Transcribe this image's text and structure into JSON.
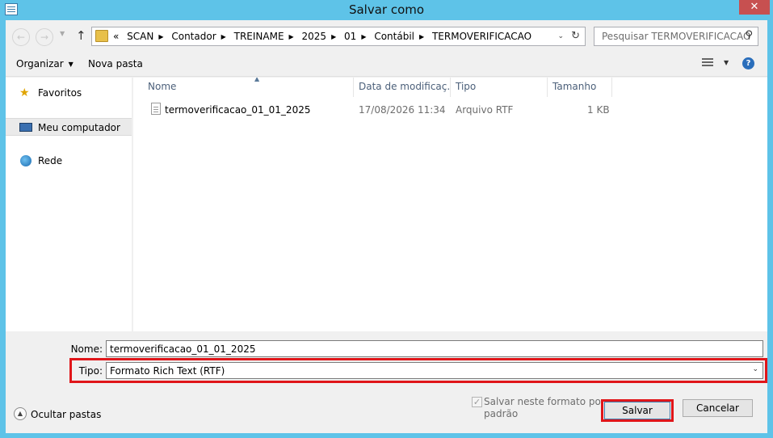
{
  "window": {
    "title": "Salvar como",
    "close_glyph": "✕"
  },
  "nav": {
    "back_glyph": "←",
    "forward_glyph": "→",
    "dropdown_glyph": "▼",
    "up_glyph": "↑"
  },
  "address": {
    "overflow": "«",
    "crumbs": [
      "SCAN",
      "Contador",
      "TREINAME",
      "2025",
      "01",
      "Contábil",
      "TERMOVERIFICACAO"
    ],
    "separator": "▶",
    "dropdown_glyph": "⌄",
    "refresh_glyph": "↻"
  },
  "search": {
    "placeholder": "Pesquisar TERMOVERIFICACAO",
    "icon_glyph": "⚲"
  },
  "toolbar": {
    "organize": "Organizar",
    "caret": "▼",
    "new_folder": "Nova pasta",
    "view_dd": "▼",
    "help_glyph": "?"
  },
  "sidebar": {
    "items": [
      {
        "label": "Favoritos",
        "icon": "star-icon",
        "glyph": "★"
      },
      {
        "label": "Meu computador",
        "icon": "computer-icon"
      },
      {
        "label": "Rede",
        "icon": "network-icon"
      }
    ]
  },
  "filelist": {
    "columns": [
      "Nome",
      "Data de modificaç...",
      "Tipo",
      "Tamanho"
    ],
    "sort_glyph": "▲",
    "rows": [
      {
        "name": "termoverificacao_01_01_2025",
        "modified": "17/08/2026 11:34",
        "type": "Arquivo RTF",
        "size": "1 KB"
      }
    ]
  },
  "form": {
    "name_label": "Nome:",
    "name_value": "termoverificacao_01_01_2025",
    "type_label": "Tipo:",
    "type_value": "Formato Rich Text (RTF)",
    "type_arrow": "⌄",
    "hide_folders": "Ocultar pastas",
    "hide_glyph": "▲",
    "save_default_label": "Salvar neste formato por padrão",
    "check_glyph": "✓",
    "save_button": "Salvar",
    "cancel_button": "Cancelar"
  },
  "colors": {
    "frame": "#5ec3e8",
    "highlight_box": "#e0161a",
    "close": "#c75050"
  }
}
